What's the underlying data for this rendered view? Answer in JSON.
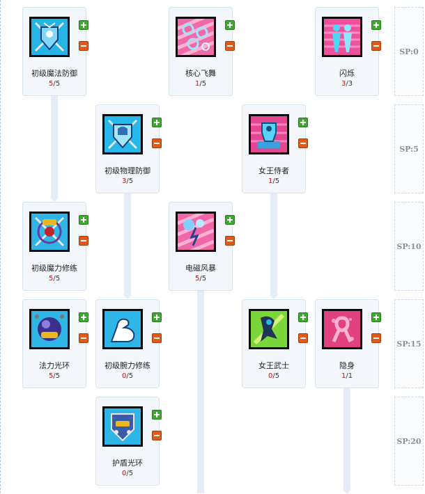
{
  "skills": [
    {
      "name": "初级魔法防御",
      "current": "5",
      "max": "5"
    },
    {
      "name": "核心飞舞",
      "current": "1",
      "max": "5"
    },
    {
      "name": "闪烁",
      "current": "3",
      "max": "3"
    },
    {
      "name": "初级物理防御",
      "current": "3",
      "max": "5"
    },
    {
      "name": "女王侍者",
      "current": "1",
      "max": "5"
    },
    {
      "name": "初级魔力修练",
      "current": "5",
      "max": "5"
    },
    {
      "name": "电磁风暴",
      "current": "5",
      "max": "5"
    },
    {
      "name": "法力光环",
      "current": "5",
      "max": "5"
    },
    {
      "name": "初级腕力修练",
      "current": "0",
      "max": "5"
    },
    {
      "name": "女王武士",
      "current": "0",
      "max": "5"
    },
    {
      "name": "隐身",
      "current": "1",
      "max": "1"
    },
    {
      "name": "护盾光环",
      "current": "0",
      "max": "5"
    }
  ],
  "level_separator": "/",
  "sp_tiers": [
    "SP:0",
    "SP:5",
    "SP:10",
    "SP:15",
    "SP:20"
  ],
  "colors": {
    "current_level": "#c0171c",
    "card_bg": "#f3f7fc",
    "plus": "#3fa82e",
    "minus": "#e15a1a",
    "connector": "#e4edf7"
  },
  "icons": [
    "shield-staff-icon",
    "orbs-dance-icon",
    "twin-figures-icon",
    "shield-helmet-icon",
    "queen-servant-icon",
    "pow-staff-icon",
    "electric-storm-icon",
    "pow-orb-icon",
    "flexed-arm-icon",
    "queen-warrior-icon",
    "ribbon-icon",
    "def-shield-icon"
  ]
}
